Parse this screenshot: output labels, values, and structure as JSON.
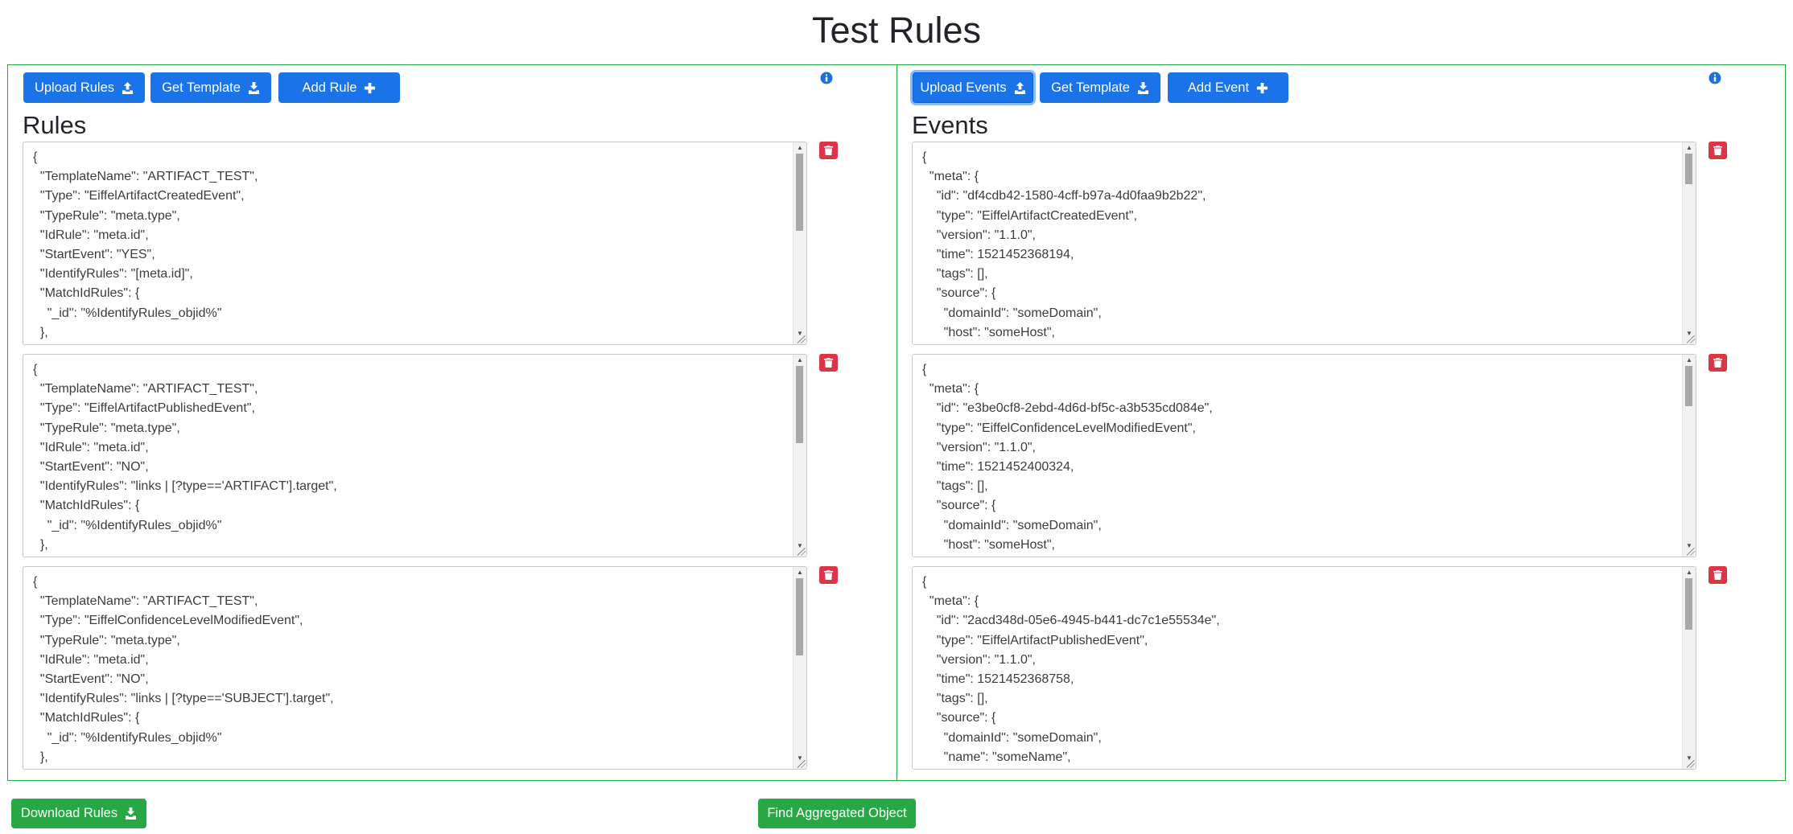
{
  "page": {
    "title": "Test Rules"
  },
  "rules": {
    "title": "Rules",
    "upload_label": "Upload Rules",
    "template_label": "Get Template",
    "add_label": "Add Rule",
    "editors": [
      "{\n  \"TemplateName\": \"ARTIFACT_TEST\",\n  \"Type\": \"EiffelArtifactCreatedEvent\",\n  \"TypeRule\": \"meta.type\",\n  \"IdRule\": \"meta.id\",\n  \"StartEvent\": \"YES\",\n  \"IdentifyRules\": \"[meta.id]\",\n  \"MatchIdRules\": {\n    \"_id\": \"%IdentifyRules_objid%\"\n  },",
      "{\n  \"TemplateName\": \"ARTIFACT_TEST\",\n  \"Type\": \"EiffelArtifactPublishedEvent\",\n  \"TypeRule\": \"meta.type\",\n  \"IdRule\": \"meta.id\",\n  \"StartEvent\": \"NO\",\n  \"IdentifyRules\": \"links | [?type=='ARTIFACT'].target\",\n  \"MatchIdRules\": {\n    \"_id\": \"%IdentifyRules_objid%\"\n  },",
      "{\n  \"TemplateName\": \"ARTIFACT_TEST\",\n  \"Type\": \"EiffelConfidenceLevelModifiedEvent\",\n  \"TypeRule\": \"meta.type\",\n  \"IdRule\": \"meta.id\",\n  \"StartEvent\": \"NO\",\n  \"IdentifyRules\": \"links | [?type=='SUBJECT'].target\",\n  \"MatchIdRules\": {\n    \"_id\": \"%IdentifyRules_objid%\"\n  },"
    ]
  },
  "events": {
    "title": "Events",
    "upload_label": "Upload Events",
    "template_label": "Get Template",
    "add_label": "Add Event",
    "editors": [
      "{\n  \"meta\": {\n    \"id\": \"df4cdb42-1580-4cff-b97a-4d0faa9b2b22\",\n    \"type\": \"EiffelArtifactCreatedEvent\",\n    \"version\": \"1.1.0\",\n    \"time\": 1521452368194,\n    \"tags\": [],\n    \"source\": {\n      \"domainId\": \"someDomain\",\n      \"host\": \"someHost\",",
      "{\n  \"meta\": {\n    \"id\": \"e3be0cf8-2ebd-4d6d-bf5c-a3b535cd084e\",\n    \"type\": \"EiffelConfidenceLevelModifiedEvent\",\n    \"version\": \"1.1.0\",\n    \"time\": 1521452400324,\n    \"tags\": [],\n    \"source\": {\n      \"domainId\": \"someDomain\",\n      \"host\": \"someHost\",",
      "{\n  \"meta\": {\n    \"id\": \"2acd348d-05e6-4945-b441-dc7c1e55534e\",\n    \"type\": \"EiffelArtifactPublishedEvent\",\n    \"version\": \"1.1.0\",\n    \"time\": 1521452368758,\n    \"tags\": [],\n    \"source\": {\n      \"domainId\": \"someDomain\",\n      \"name\": \"someName\","
    ]
  },
  "footer": {
    "download_label": "Download Rules",
    "find_label": "Find Aggregated Object"
  },
  "colors": {
    "primary": "#1a73e8",
    "success": "#28a745",
    "danger": "#dc3545",
    "info": "#1e6fd9"
  }
}
